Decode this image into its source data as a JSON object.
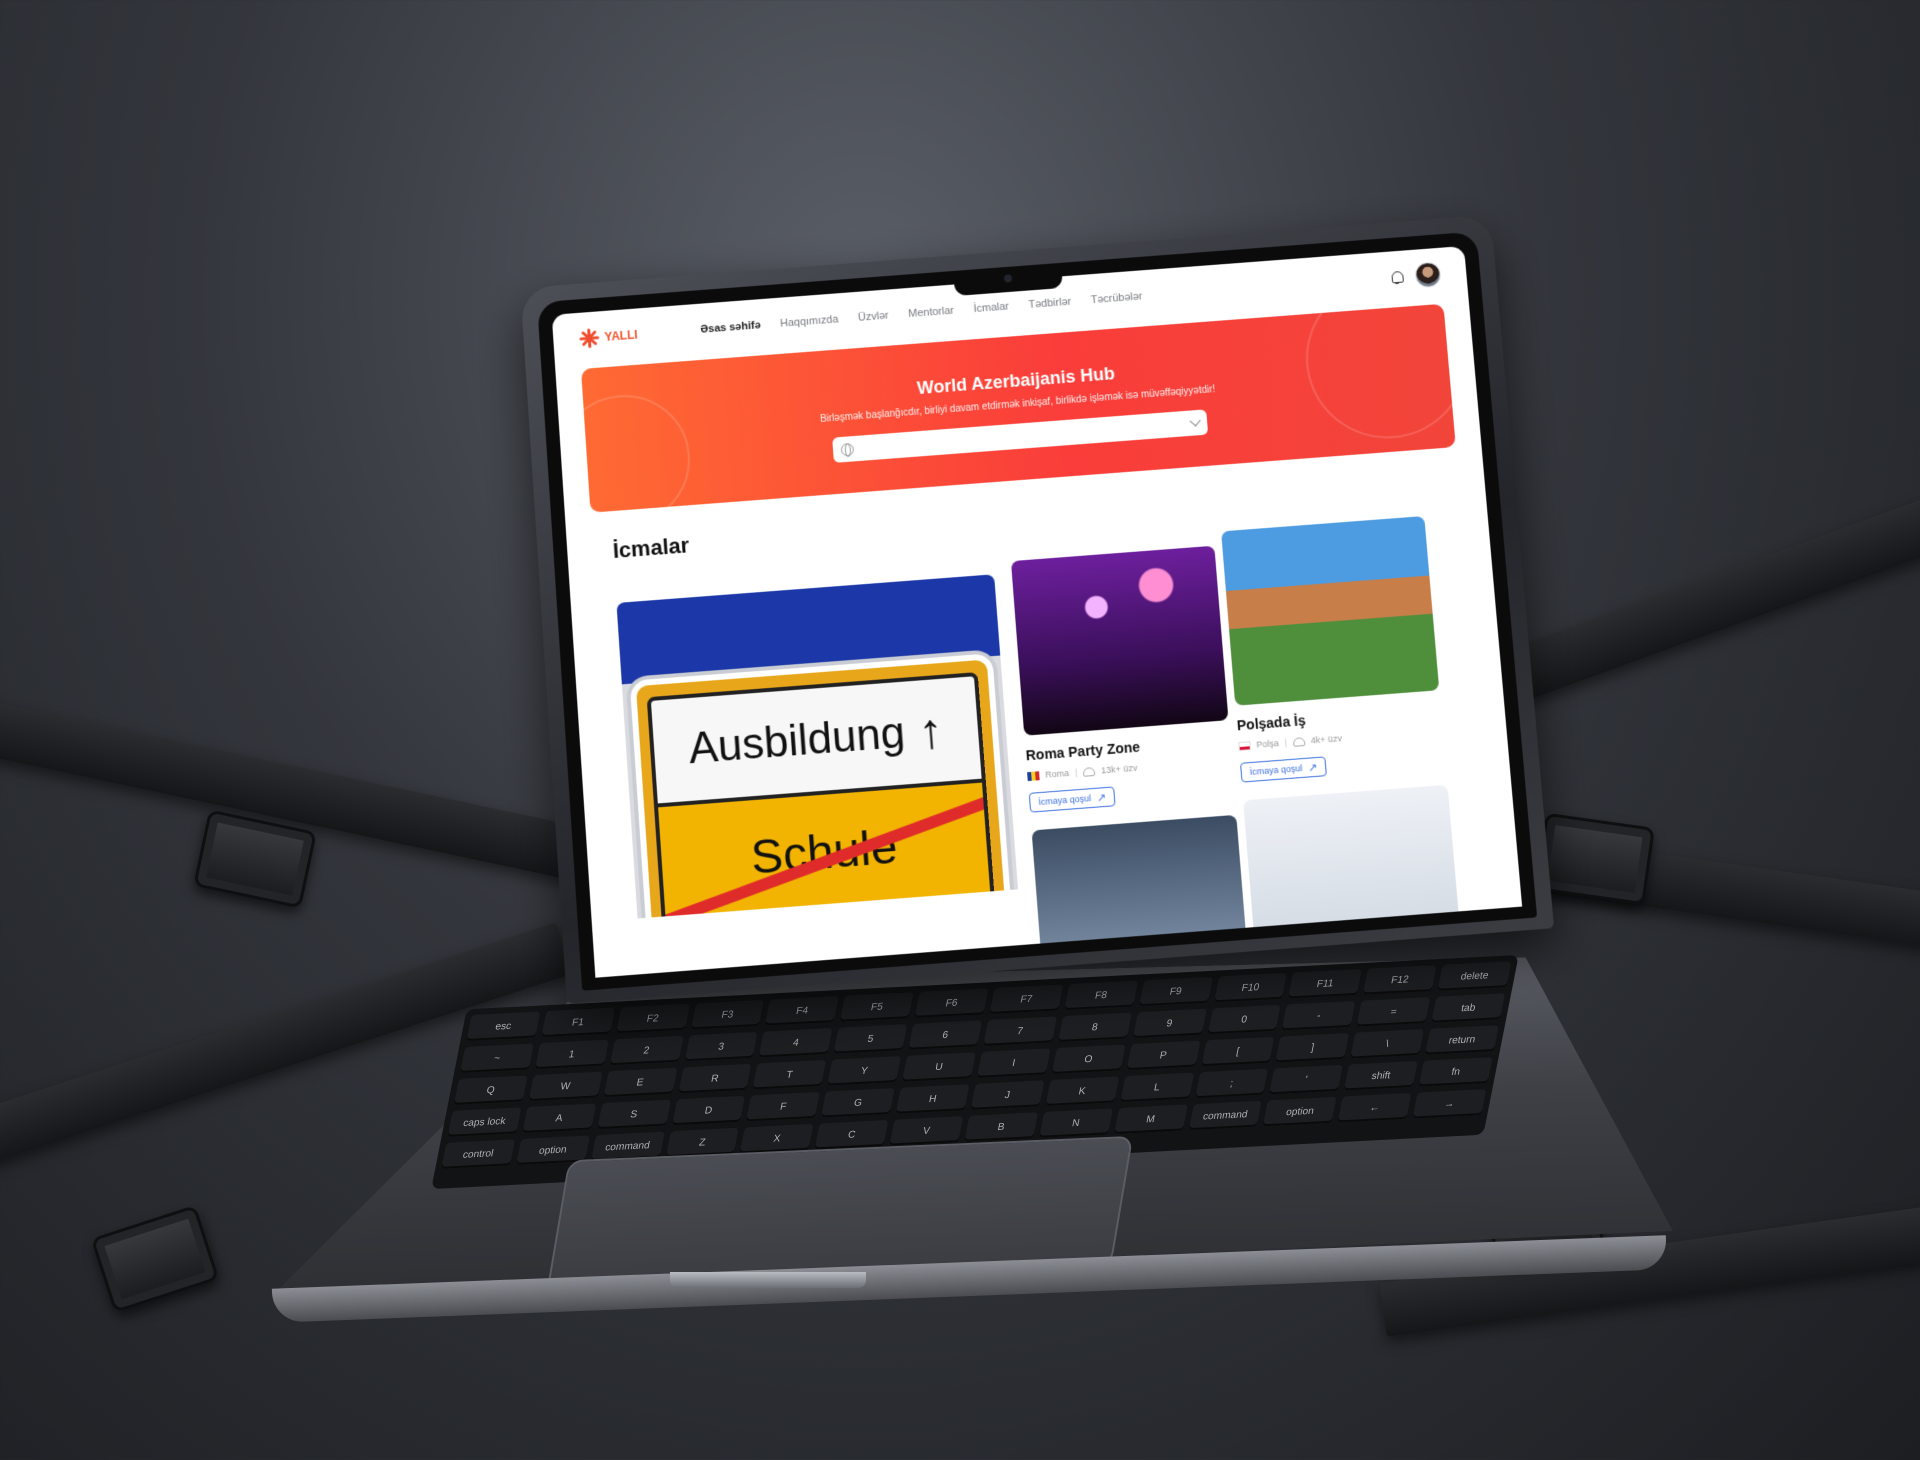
{
  "site": {
    "logo_text": "YALLI",
    "nav": {
      "items": [
        {
          "label": "Əsas səhifə",
          "active": true
        },
        {
          "label": "Haqqımızda"
        },
        {
          "label": "Üzvlər"
        },
        {
          "label": "Mentorlar"
        },
        {
          "label": "İcmalar"
        },
        {
          "label": "Tədbirlər"
        },
        {
          "label": "Təcrübələr"
        }
      ]
    },
    "hero": {
      "title": "World Azerbaijanis Hub",
      "subtitle": "Birləşmək başlanğıcdır, birliyi davam etdirmək inkişaf, birlikdə işləmək isə müvəffəqiyyətdir!",
      "search_placeholder": ""
    },
    "section_title": "İcmalar",
    "featured_card": {
      "sign_top": "Ausbildung",
      "sign_bottom": "Schule"
    },
    "cards": [
      {
        "title": "Roma Party Zone",
        "location": "Roma",
        "members": "13k+ üzv",
        "button": "İcmaya qoşul",
        "flag": "ro"
      },
      {
        "title": "Polşada İş",
        "location": "Polşa",
        "members": "4k+ üzv",
        "button": "İcmaya qoşul",
        "flag": "pl"
      }
    ],
    "colors": {
      "accent": "#f0532e",
      "hero_start": "#ff6a33",
      "hero_end": "#f2453a",
      "link_blue": "#3c6fe0"
    }
  },
  "keyboard": {
    "keys": [
      "esc",
      "F1",
      "F2",
      "F3",
      "F4",
      "F5",
      "F6",
      "F7",
      "F8",
      "F9",
      "F10",
      "F11",
      "F12",
      "delete",
      "~",
      "1",
      "2",
      "3",
      "4",
      "5",
      "6",
      "7",
      "8",
      "9",
      "0",
      "-",
      "=",
      "tab",
      "Q",
      "W",
      "E",
      "R",
      "T",
      "Y",
      "U",
      "I",
      "O",
      "P",
      "[",
      "]",
      "\\",
      "return",
      "caps lock",
      "A",
      "S",
      "D",
      "F",
      "G",
      "H",
      "J",
      "K",
      "L",
      ";",
      "'",
      "shift",
      "fn",
      "control",
      "option",
      "command",
      "Z",
      "X",
      "C",
      "V",
      "B",
      "N",
      "M",
      "command",
      "option",
      "←",
      "→"
    ]
  }
}
